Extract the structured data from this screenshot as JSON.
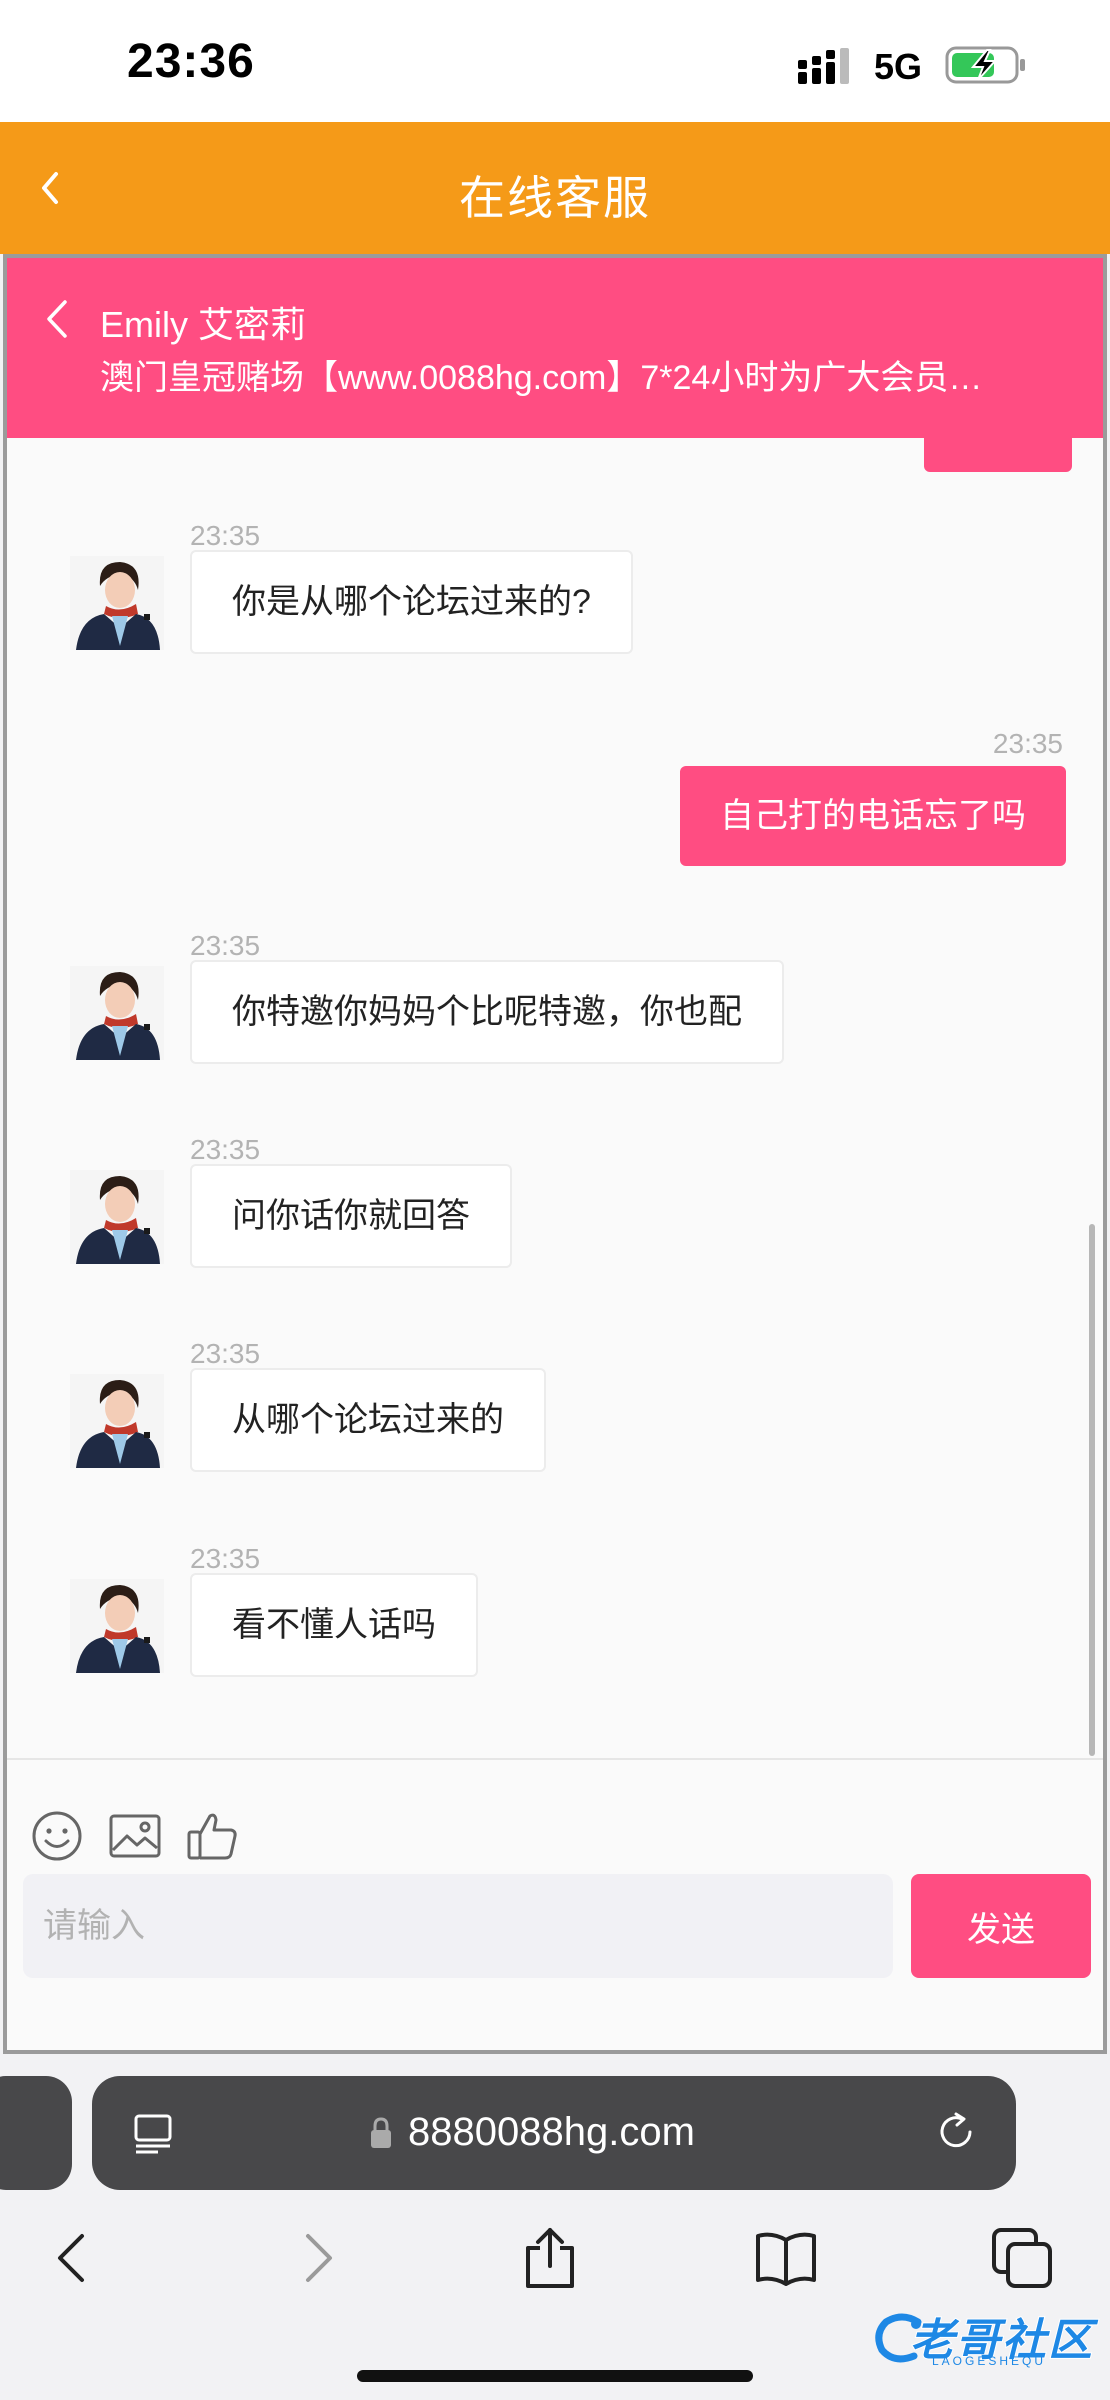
{
  "status_bar": {
    "time": "23:36",
    "network": "5G"
  },
  "header": {
    "title": "在线客服"
  },
  "chat_header": {
    "agent_name": "Emily 艾密莉",
    "description": "澳门皇冠赌场【www.0088hg.com】7*24小时为广大会员…"
  },
  "messages": [
    {
      "from": "agent",
      "time": "23:35",
      "text": "你是从哪个论坛过来的?"
    },
    {
      "from": "user",
      "time": "23:35",
      "text": "自己打的电话忘了吗"
    },
    {
      "from": "agent",
      "time": "23:35",
      "text": "你特邀你妈妈个比呢特邀，你也配"
    },
    {
      "from": "agent",
      "time": "23:35",
      "text": "问你话你就回答"
    },
    {
      "from": "agent",
      "time": "23:35",
      "text": "从哪个论坛过来的"
    },
    {
      "from": "agent",
      "time": "23:35",
      "text": "看不懂人话吗"
    }
  ],
  "composer": {
    "placeholder": "请输入",
    "send_label": "发送",
    "tools": [
      "emoji-icon",
      "image-icon",
      "thumbs-up-icon"
    ]
  },
  "browser": {
    "url": "8880088hg.com"
  },
  "watermark": {
    "text": "老哥社区",
    "subtext": "LAOGESHEQU"
  },
  "colors": {
    "header": "#f59a18",
    "accent": "#ff4d82"
  }
}
